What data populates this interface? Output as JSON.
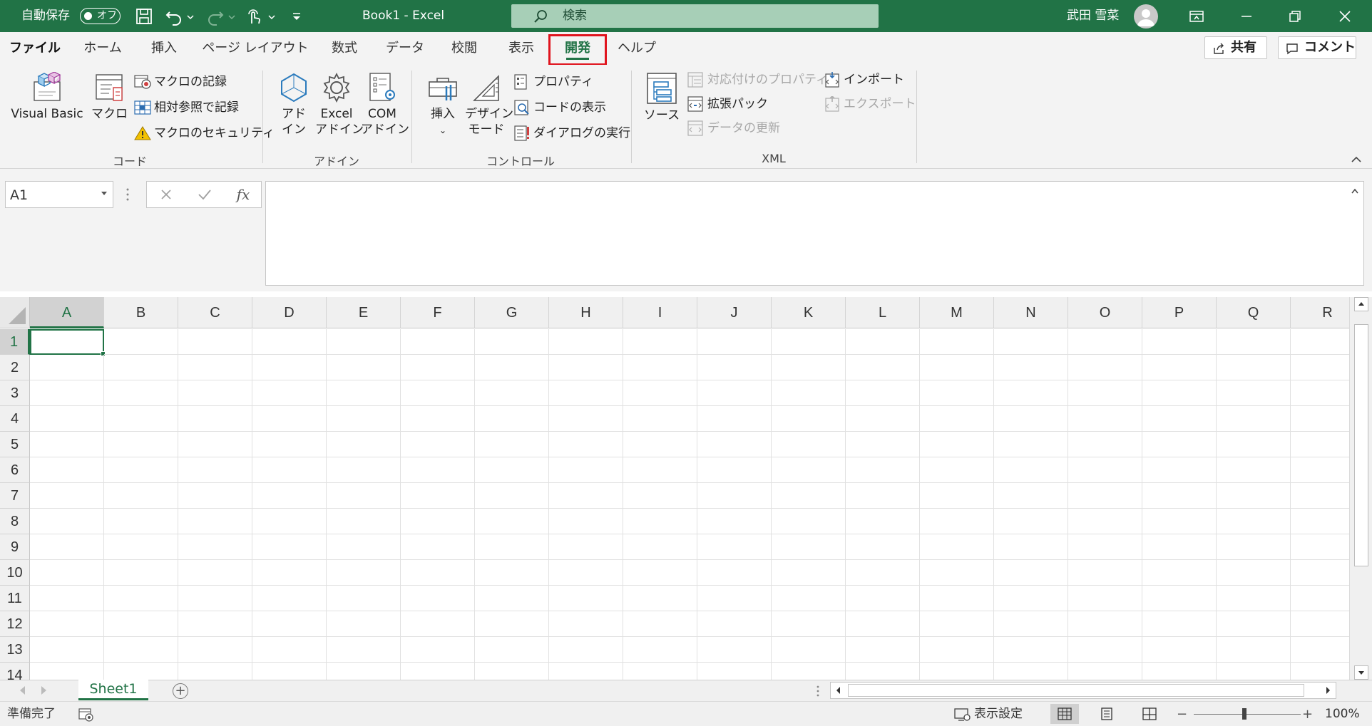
{
  "titlebar": {
    "autosave_label": "自動保存",
    "autosave_state": "オフ",
    "document_title": "Book1  -  Excel",
    "search_placeholder": "検索",
    "user_name": "武田 雪菜",
    "accent_color": "#217346"
  },
  "tabs": [
    {
      "label": "ファイル",
      "key": "file"
    },
    {
      "label": "ホーム",
      "key": "home"
    },
    {
      "label": "挿入",
      "key": "insert"
    },
    {
      "label": "ページ レイアウト",
      "key": "page-layout"
    },
    {
      "label": "数式",
      "key": "formulas"
    },
    {
      "label": "データ",
      "key": "data"
    },
    {
      "label": "校閲",
      "key": "review"
    },
    {
      "label": "表示",
      "key": "view"
    },
    {
      "label": "開発",
      "key": "developer",
      "active": true
    },
    {
      "label": "ヘルプ",
      "key": "help"
    }
  ],
  "actions": {
    "share": "共有",
    "comment": "コメント"
  },
  "ribbon": {
    "code": {
      "label": "コード",
      "visual_basic": "Visual Basic",
      "macros": "マクロ",
      "record_macro": "マクロの記録",
      "relative_refs": "相対参照で記録",
      "macro_security": "マクロのセキュリティ"
    },
    "addins": {
      "label": "アドイン",
      "addins_l1": "アド",
      "addins_l2": "イン",
      "excel_addins_l1": "Excel",
      "excel_addins_l2": "アドイン",
      "com_addins_l1": "COM",
      "com_addins_l2": "アドイン"
    },
    "controls": {
      "label": "コントロール",
      "insert": "挿入",
      "design_mode_l1": "デザイン",
      "design_mode_l2": "モード",
      "properties": "プロパティ",
      "view_code": "コードの表示",
      "run_dialog": "ダイアログの実行"
    },
    "xml": {
      "label": "XML",
      "source": "ソース",
      "map_properties": "対応付けのプロパティ",
      "expansion_packs": "拡張パック",
      "refresh_data": "データの更新",
      "import": "インポート",
      "export": "エクスポート"
    }
  },
  "formula_bar": {
    "name_box": "A1",
    "fx_label": "fx",
    "content": ""
  },
  "grid": {
    "columns": [
      "A",
      "B",
      "C",
      "D",
      "E",
      "F",
      "G",
      "H",
      "I",
      "J",
      "K",
      "L",
      "M",
      "N",
      "O",
      "P",
      "Q",
      "R"
    ],
    "rows": [
      "1",
      "2",
      "3",
      "4",
      "5",
      "6",
      "7",
      "8",
      "9",
      "10",
      "11",
      "12",
      "13",
      "14"
    ],
    "selected_cell": "A1"
  },
  "sheets": [
    {
      "name": "Sheet1",
      "active": true
    }
  ],
  "statusbar": {
    "ready": "準備完了",
    "display_settings": "表示設定",
    "zoom": "100%",
    "zoom_minus": "−",
    "zoom_plus": "+"
  }
}
